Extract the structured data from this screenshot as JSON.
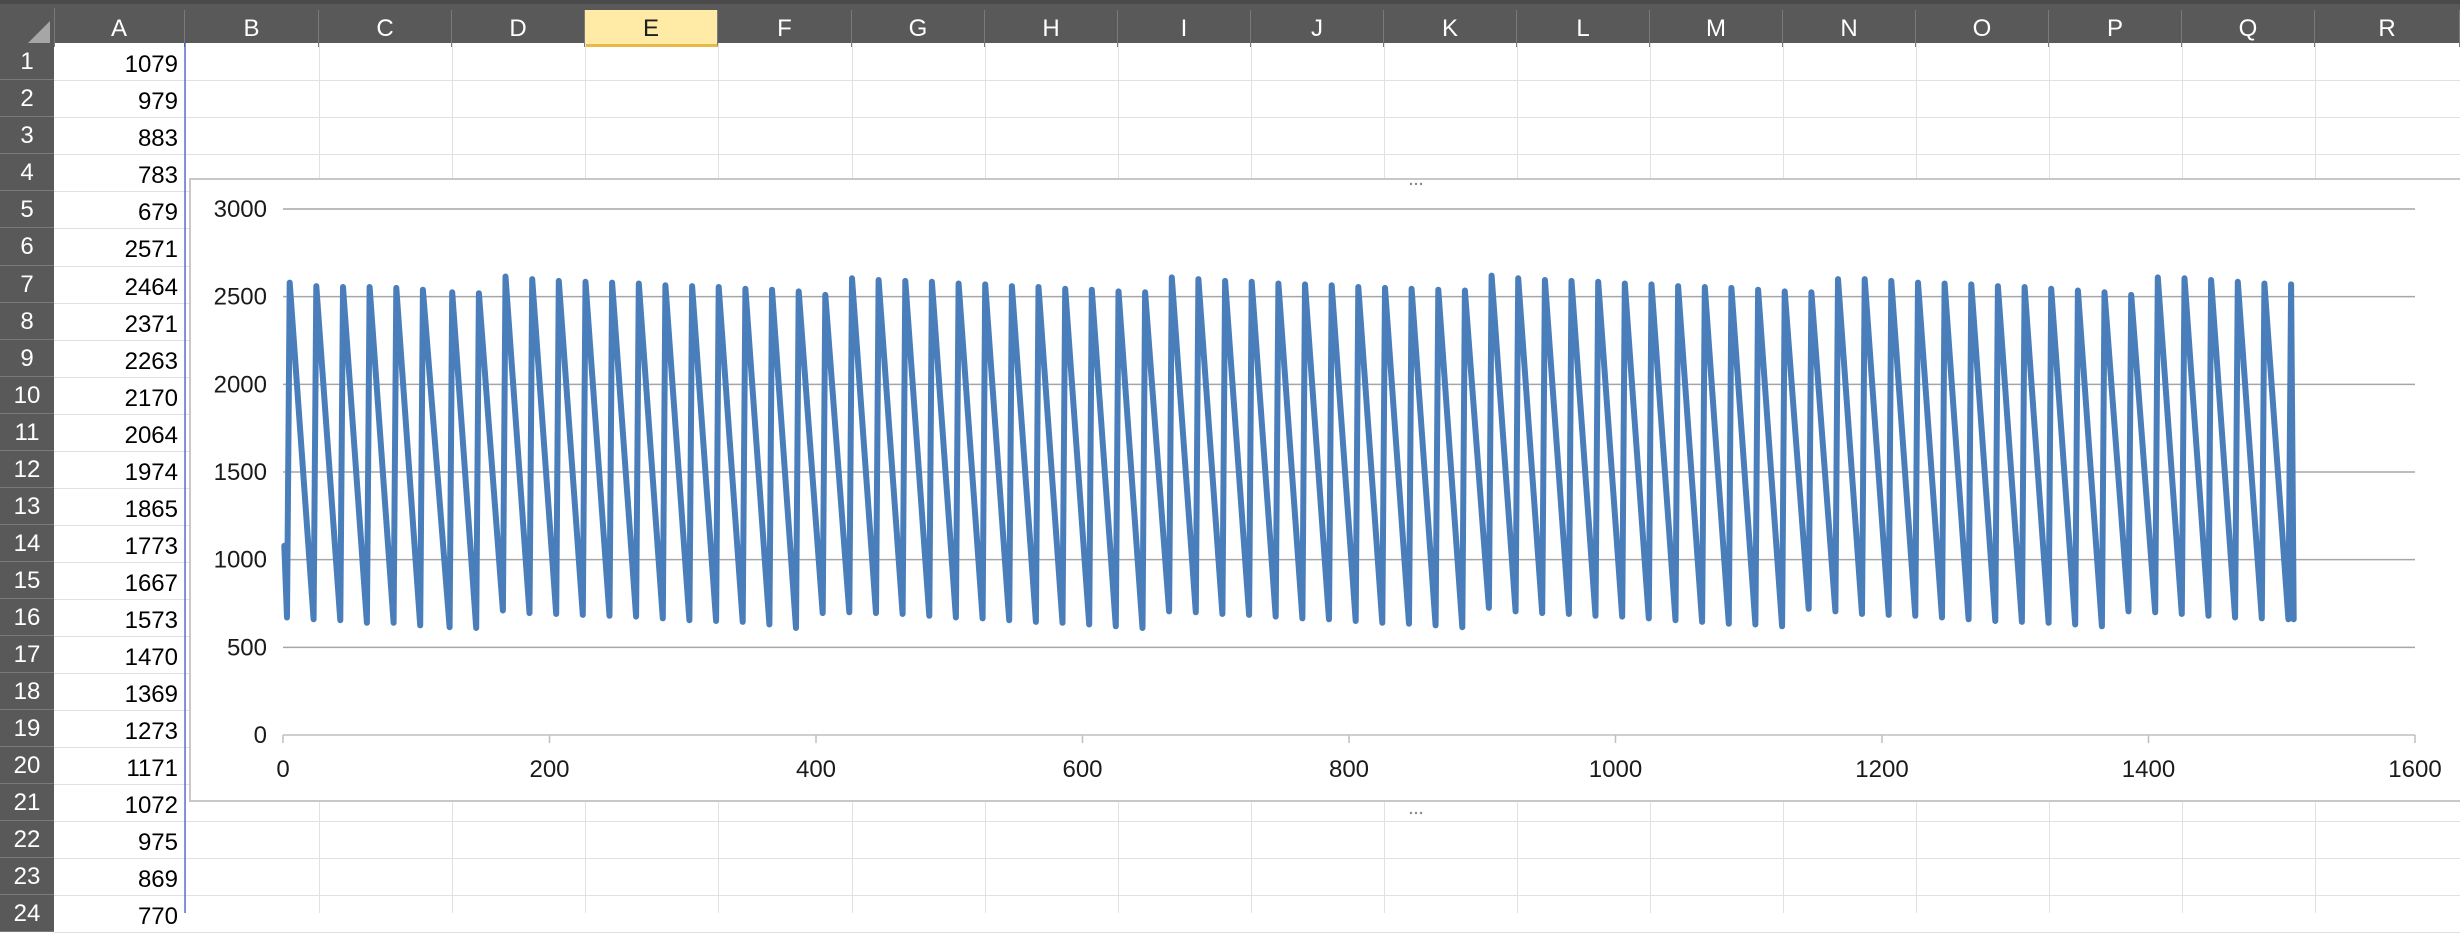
{
  "columns": [
    "A",
    "B",
    "C",
    "D",
    "E",
    "F",
    "G",
    "H",
    "I",
    "J",
    "K",
    "L",
    "M",
    "N",
    "O",
    "P",
    "Q",
    "R"
  ],
  "selected_column": "E",
  "rows": [
    {
      "num": "1",
      "a": "1079"
    },
    {
      "num": "2",
      "a": "979"
    },
    {
      "num": "3",
      "a": "883"
    },
    {
      "num": "4",
      "a": "783"
    },
    {
      "num": "5",
      "a": "679"
    },
    {
      "num": "6",
      "a": "2571"
    },
    {
      "num": "7",
      "a": "2464"
    },
    {
      "num": "8",
      "a": "2371"
    },
    {
      "num": "9",
      "a": "2263"
    },
    {
      "num": "10",
      "a": "2170"
    },
    {
      "num": "11",
      "a": "2064"
    },
    {
      "num": "12",
      "a": "1974"
    },
    {
      "num": "13",
      "a": "1865"
    },
    {
      "num": "14",
      "a": "1773"
    },
    {
      "num": "15",
      "a": "1667"
    },
    {
      "num": "16",
      "a": "1573"
    },
    {
      "num": "17",
      "a": "1470"
    },
    {
      "num": "18",
      "a": "1369"
    },
    {
      "num": "19",
      "a": "1273"
    },
    {
      "num": "20",
      "a": "1171"
    },
    {
      "num": "21",
      "a": "1072"
    },
    {
      "num": "22",
      "a": "975"
    },
    {
      "num": "23",
      "a": "869"
    },
    {
      "num": "24",
      "a": "770"
    }
  ],
  "colors": {
    "header_bg": "#595959",
    "selected_header_bg": "#ffeaa6",
    "series": "#4a7ebb",
    "gridline": "#a6a6a6"
  },
  "chart_data": {
    "type": "scatter",
    "mode": "lines",
    "xlim": [
      0,
      1600
    ],
    "ylim": [
      0,
      3000
    ],
    "xticks": [
      0,
      200,
      400,
      600,
      800,
      1000,
      1200,
      1400,
      1600
    ],
    "yticks": [
      0,
      500,
      1000,
      1500,
      2000,
      2500,
      3000
    ],
    "xtick_labels": [
      "0",
      "200",
      "400",
      "600",
      "800",
      "1000",
      "1200",
      "1400",
      "1600"
    ],
    "ytick_labels": [
      "0",
      "500",
      "1000",
      "1500",
      "2000",
      "2500",
      "3000"
    ],
    "grid": "horizontal",
    "legend": "none",
    "series": [
      {
        "color": "#4a7ebb",
        "peaks": [
          [
            5,
            2580
          ],
          [
            25,
            2560
          ],
          [
            45,
            2555
          ],
          [
            65,
            2555
          ],
          [
            85,
            2550
          ],
          [
            105,
            2540
          ],
          [
            127,
            2525
          ],
          [
            147,
            2520
          ],
          [
            167,
            2615
          ],
          [
            187,
            2600
          ],
          [
            207,
            2590
          ],
          [
            227,
            2585
          ],
          [
            247,
            2580
          ],
          [
            267,
            2575
          ],
          [
            287,
            2565
          ],
          [
            307,
            2560
          ],
          [
            327,
            2555
          ],
          [
            347,
            2545
          ],
          [
            367,
            2540
          ],
          [
            387,
            2530
          ],
          [
            407,
            2510
          ],
          [
            427,
            2605
          ],
          [
            447,
            2595
          ],
          [
            467,
            2590
          ],
          [
            487,
            2585
          ],
          [
            507,
            2575
          ],
          [
            527,
            2570
          ],
          [
            547,
            2560
          ],
          [
            567,
            2555
          ],
          [
            587,
            2545
          ],
          [
            607,
            2540
          ],
          [
            627,
            2530
          ],
          [
            647,
            2525
          ],
          [
            667,
            2610
          ],
          [
            687,
            2600
          ],
          [
            707,
            2590
          ],
          [
            727,
            2585
          ],
          [
            747,
            2575
          ],
          [
            767,
            2570
          ],
          [
            787,
            2565
          ],
          [
            807,
            2555
          ],
          [
            827,
            2550
          ],
          [
            847,
            2545
          ],
          [
            867,
            2540
          ],
          [
            887,
            2535
          ],
          [
            907,
            2620
          ],
          [
            927,
            2605
          ],
          [
            947,
            2595
          ],
          [
            967,
            2590
          ],
          [
            987,
            2585
          ],
          [
            1007,
            2575
          ],
          [
            1027,
            2570
          ],
          [
            1047,
            2560
          ],
          [
            1067,
            2555
          ],
          [
            1087,
            2550
          ],
          [
            1107,
            2540
          ],
          [
            1127,
            2530
          ],
          [
            1147,
            2525
          ],
          [
            1167,
            2600
          ],
          [
            1187,
            2600
          ],
          [
            1207,
            2590
          ],
          [
            1227,
            2580
          ],
          [
            1247,
            2575
          ],
          [
            1267,
            2570
          ],
          [
            1287,
            2560
          ],
          [
            1307,
            2555
          ],
          [
            1327,
            2545
          ],
          [
            1347,
            2535
          ],
          [
            1367,
            2525
          ],
          [
            1387,
            2510
          ],
          [
            1407,
            2610
          ],
          [
            1427,
            2605
          ],
          [
            1447,
            2595
          ],
          [
            1467,
            2585
          ],
          [
            1487,
            2575
          ],
          [
            1507,
            2570
          ]
        ],
        "troughs": [
          [
            3,
            670
          ],
          [
            23,
            660
          ],
          [
            43,
            655
          ],
          [
            63,
            640
          ],
          [
            83,
            640
          ],
          [
            103,
            625
          ],
          [
            125,
            615
          ],
          [
            145,
            610
          ],
          [
            165,
            710
          ],
          [
            185,
            695
          ],
          [
            205,
            690
          ],
          [
            225,
            685
          ],
          [
            245,
            680
          ],
          [
            265,
            675
          ],
          [
            285,
            665
          ],
          [
            305,
            655
          ],
          [
            325,
            650
          ],
          [
            345,
            645
          ],
          [
            365,
            630
          ],
          [
            385,
            610
          ],
          [
            405,
            695
          ],
          [
            425,
            700
          ],
          [
            445,
            695
          ],
          [
            465,
            690
          ],
          [
            485,
            680
          ],
          [
            505,
            670
          ],
          [
            525,
            665
          ],
          [
            545,
            655
          ],
          [
            565,
            645
          ],
          [
            585,
            640
          ],
          [
            605,
            630
          ],
          [
            625,
            620
          ],
          [
            645,
            610
          ],
          [
            665,
            705
          ],
          [
            685,
            700
          ],
          [
            705,
            690
          ],
          [
            725,
            685
          ],
          [
            745,
            675
          ],
          [
            765,
            665
          ],
          [
            785,
            660
          ],
          [
            805,
            650
          ],
          [
            825,
            640
          ],
          [
            845,
            635
          ],
          [
            865,
            625
          ],
          [
            885,
            615
          ],
          [
            905,
            725
          ],
          [
            925,
            705
          ],
          [
            945,
            695
          ],
          [
            965,
            690
          ],
          [
            985,
            680
          ],
          [
            1005,
            675
          ],
          [
            1025,
            665
          ],
          [
            1045,
            655
          ],
          [
            1065,
            645
          ],
          [
            1085,
            635
          ],
          [
            1105,
            630
          ],
          [
            1125,
            620
          ],
          [
            1145,
            720
          ],
          [
            1165,
            705
          ],
          [
            1185,
            690
          ],
          [
            1205,
            685
          ],
          [
            1225,
            680
          ],
          [
            1245,
            670
          ],
          [
            1265,
            660
          ],
          [
            1285,
            650
          ],
          [
            1305,
            645
          ],
          [
            1325,
            640
          ],
          [
            1345,
            630
          ],
          [
            1365,
            620
          ],
          [
            1385,
            705
          ],
          [
            1405,
            700
          ],
          [
            1425,
            690
          ],
          [
            1445,
            680
          ],
          [
            1465,
            670
          ],
          [
            1485,
            665
          ],
          [
            1505,
            660
          ]
        ],
        "start": [
          1,
          1079
        ],
        "end": [
          1509,
          660
        ]
      }
    ]
  }
}
